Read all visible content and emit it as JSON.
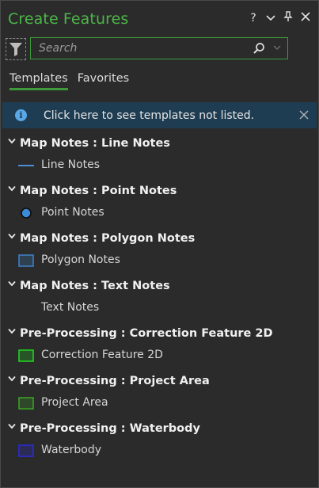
{
  "window": {
    "title": "Create Features",
    "controls": [
      "?",
      "⌄",
      "pin",
      "✕"
    ]
  },
  "search": {
    "placeholder": "Search"
  },
  "tabs": [
    {
      "label": "Templates",
      "active": true
    },
    {
      "label": "Favorites",
      "active": false
    }
  ],
  "banner": {
    "message": "Click here to see templates not listed."
  },
  "colors": {
    "accent": "#4cb648",
    "banner_bg": "#1f3d52",
    "info_icon": "#5aa7e6"
  },
  "groups": [
    {
      "title": "Map Notes : Line Notes",
      "item": {
        "label": "Line Notes",
        "symbol": "line",
        "color": "#4a8fd6"
      }
    },
    {
      "title": "Map Notes : Point Notes",
      "item": {
        "label": "Point Notes",
        "symbol": "point",
        "color": "#3d8ad8"
      }
    },
    {
      "title": "Map Notes : Polygon Notes",
      "item": {
        "label": "Polygon Notes",
        "symbol": "polygon",
        "color": "#3d7fc4"
      }
    },
    {
      "title": "Map Notes : Text Notes",
      "item": {
        "label": "Text Notes",
        "symbol": "text",
        "color": ""
      }
    },
    {
      "title": "Pre-Processing : Correction Feature 2D",
      "item": {
        "label": "Correction Feature 2D",
        "symbol": "polygon",
        "color": "#1ed21e"
      }
    },
    {
      "title": "Pre-Processing : Project Area",
      "item": {
        "label": "Project Area",
        "symbol": "polygon",
        "color": "#3aa024"
      }
    },
    {
      "title": "Pre-Processing : Waterbody",
      "item": {
        "label": "Waterbody",
        "symbol": "polygon",
        "color": "#2a2ad6"
      }
    }
  ]
}
